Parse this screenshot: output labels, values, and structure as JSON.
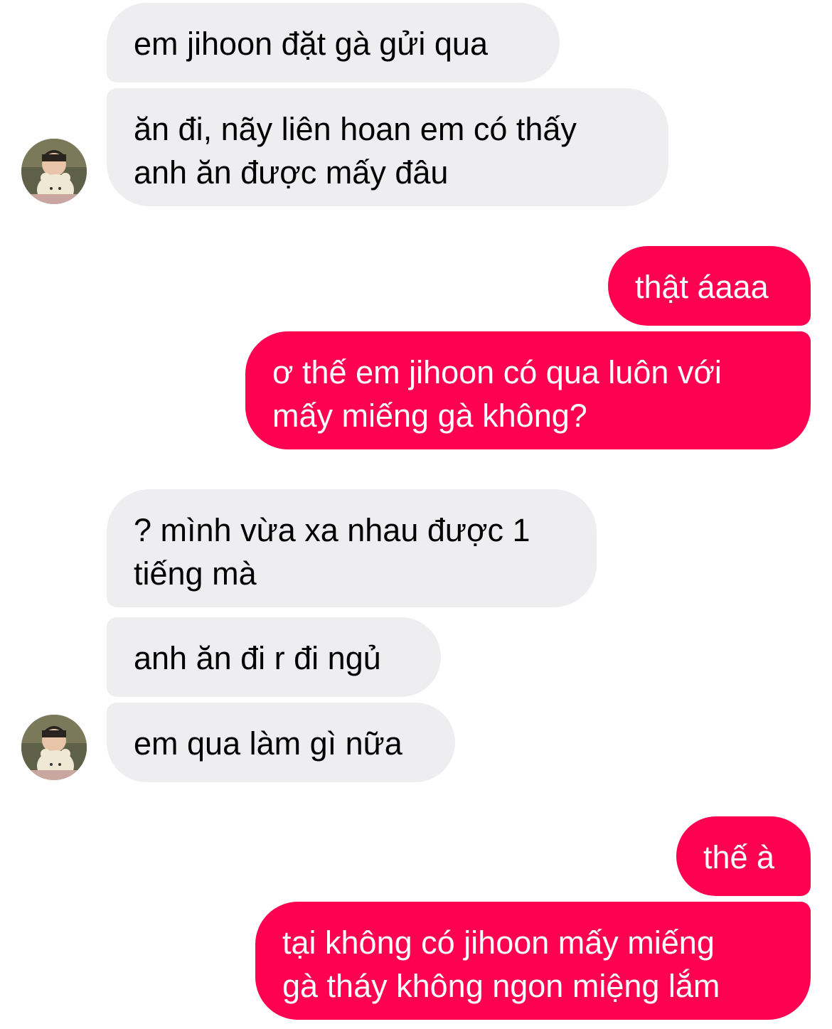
{
  "colors": {
    "received_bubble": "#eeeef0",
    "received_text": "#000000",
    "sent_bubble": "#ff0151",
    "sent_text": "#ffffff"
  },
  "messages": [
    {
      "side": "received",
      "text": "em jihoon đặt gà gửi qua"
    },
    {
      "side": "received",
      "text": "ăn đi, nãy liên hoan em có thấy\nanh ăn được mấy đâu"
    },
    {
      "side": "sent",
      "text": "thật áaaa"
    },
    {
      "side": "sent",
      "text": "ơ thế em jihoon có qua luôn với\nmấy miếng gà không?"
    },
    {
      "side": "received",
      "text": "? mình vừa xa nhau được 1\ntiếng mà"
    },
    {
      "side": "received",
      "text": "anh ăn đi r đi ngủ"
    },
    {
      "side": "received",
      "text": "em qua làm gì nữa"
    },
    {
      "side": "sent",
      "text": "thế à"
    },
    {
      "side": "sent",
      "text": "tại không có jihoon mấy miếng\ngà tháy không ngon miệng lắm"
    }
  ],
  "avatars": [
    {
      "icon": "contact-avatar-photo"
    },
    {
      "icon": "contact-avatar-photo"
    }
  ]
}
